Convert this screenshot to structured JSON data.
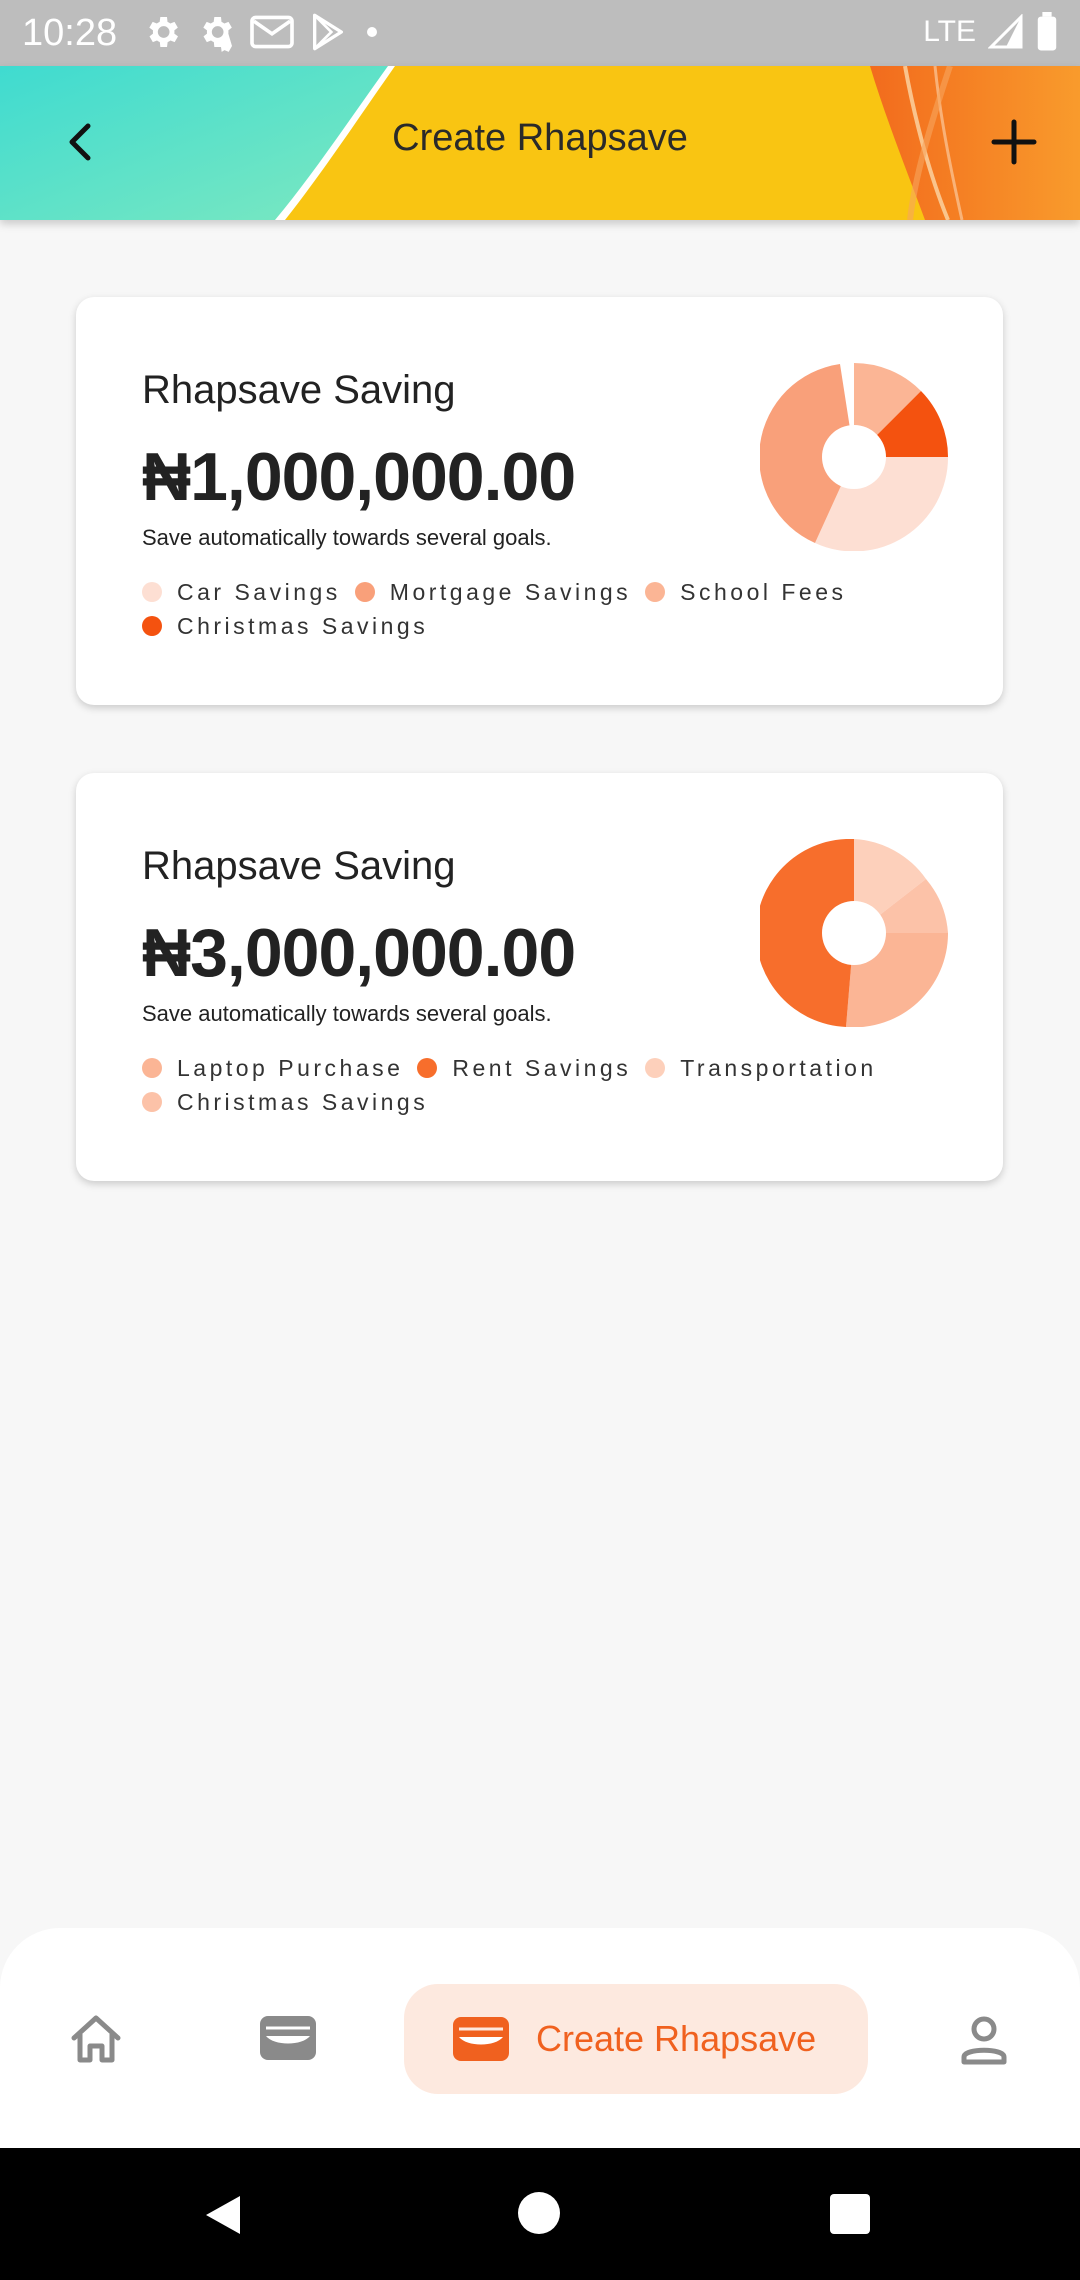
{
  "status_bar": {
    "time": "10:28",
    "network": "LTE"
  },
  "header": {
    "title": "Create Rhapsave",
    "back_icon": "chevron-left-icon",
    "add_icon": "plus-icon"
  },
  "cards": [
    {
      "title": "Rhapsave Saving",
      "amount": "₦1,000,000.00",
      "description": "Save automatically towards several goals.",
      "legend": [
        {
          "label": "Car Savings",
          "color": "#fddfd3"
        },
        {
          "label": "Mortgage Savings",
          "color": "#f9a07a"
        },
        {
          "label": "School Fees",
          "color": "#fbb595"
        },
        {
          "label": "Christmas Savings",
          "color": "#f4520f"
        }
      ]
    },
    {
      "title": "Rhapsave Saving",
      "amount": "₦3,000,000.00",
      "description": "Save automatically towards several goals.",
      "legend": [
        {
          "label": "Laptop Purchase",
          "color": "#fbb595"
        },
        {
          "label": "Rent Savings",
          "color": "#f76e2c"
        },
        {
          "label": "Transportation",
          "color": "#fdd0bb"
        },
        {
          "label": "Christmas Savings",
          "color": "#fcc2a8"
        }
      ]
    }
  ],
  "bottom_nav": {
    "items": [
      {
        "name": "home",
        "icon": "home-icon"
      },
      {
        "name": "wallet",
        "icon": "wallet-icon"
      },
      {
        "name": "create-rhapsave",
        "icon": "wallet-icon",
        "label": "Create Rhapsave",
        "active": true
      },
      {
        "name": "profile",
        "icon": "profile-icon"
      }
    ],
    "accent_color": "#f0611f",
    "active_bg": "#fde9df"
  }
}
